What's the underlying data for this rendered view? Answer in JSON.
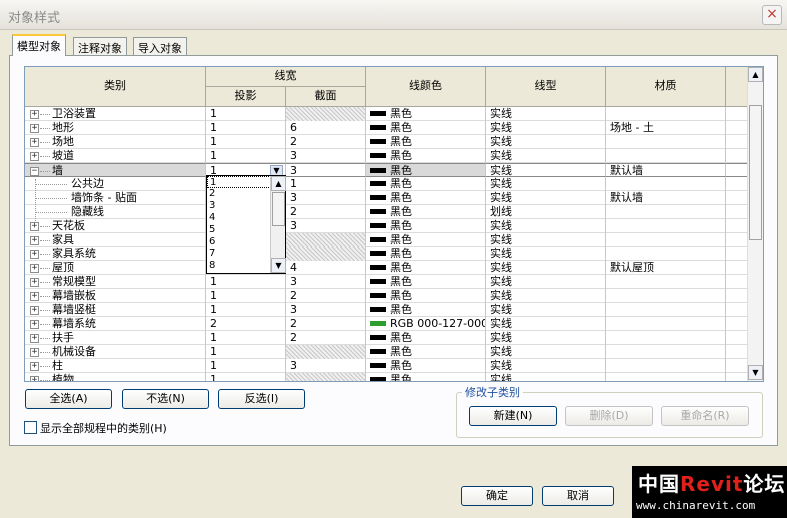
{
  "window": {
    "title": "对象样式",
    "close_symbol": "×"
  },
  "tabs": [
    {
      "label": "模型对象",
      "active": true
    },
    {
      "label": "注释对象",
      "active": false
    },
    {
      "label": "导入对象",
      "active": false
    }
  ],
  "grid": {
    "headers": {
      "category": "类别",
      "line_weight": "线宽",
      "projection": "投影",
      "cut": "截面",
      "line_color": "线颜色",
      "line_pattern": "线型",
      "material": "材质"
    },
    "rows": [
      {
        "name": "卫浴装置",
        "expander": "+",
        "proj": "1",
        "cut": "",
        "cut_hatched": true,
        "color": "黑色",
        "swatch": "#000000",
        "pattern": "实线",
        "material": ""
      },
      {
        "name": "地形",
        "expander": "+",
        "proj": "1",
        "cut": "6",
        "cut_hatched": false,
        "color": "黑色",
        "swatch": "#000000",
        "pattern": "实线",
        "material": "场地 - 土"
      },
      {
        "name": "场地",
        "expander": "+",
        "proj": "1",
        "cut": "2",
        "cut_hatched": false,
        "color": "黑色",
        "swatch": "#000000",
        "pattern": "实线",
        "material": ""
      },
      {
        "name": "坡道",
        "expander": "+",
        "proj": "1",
        "cut": "3",
        "cut_hatched": false,
        "color": "黑色",
        "swatch": "#000000",
        "pattern": "实线",
        "material": ""
      },
      {
        "name": "墙",
        "expander": "−",
        "proj": "1",
        "cut": "3",
        "cut_hatched": false,
        "color": "黑色",
        "swatch": "#000000",
        "pattern": "实线",
        "material": "默认墙",
        "selected": true
      },
      {
        "name": "公共边",
        "child": true,
        "proj": "",
        "cut": "1",
        "cut_hatched": false,
        "color": "黑色",
        "swatch": "#000000",
        "pattern": "实线",
        "material": ""
      },
      {
        "name": "墙饰条 - 贴面",
        "child": true,
        "proj": "",
        "cut": "3",
        "cut_hatched": false,
        "color": "黑色",
        "swatch": "#000000",
        "pattern": "实线",
        "material": "默认墙"
      },
      {
        "name": "隐藏线",
        "child": true,
        "proj": "",
        "cut": "2",
        "cut_hatched": false,
        "color": "黑色",
        "swatch": "#000000",
        "pattern": "划线",
        "material": ""
      },
      {
        "name": "天花板",
        "expander": "+",
        "proj": "",
        "cut": "3",
        "cut_hatched": false,
        "color": "黑色",
        "swatch": "#000000",
        "pattern": "实线",
        "material": ""
      },
      {
        "name": "家具",
        "expander": "+",
        "proj": "",
        "cut": "",
        "cut_hatched": true,
        "color": "黑色",
        "swatch": "#000000",
        "pattern": "实线",
        "material": ""
      },
      {
        "name": "家具系统",
        "expander": "+",
        "proj": "",
        "cut": "",
        "cut_hatched": true,
        "color": "黑色",
        "swatch": "#000000",
        "pattern": "实线",
        "material": ""
      },
      {
        "name": "屋顶",
        "expander": "+",
        "proj": "",
        "cut": "4",
        "cut_hatched": false,
        "color": "黑色",
        "swatch": "#000000",
        "pattern": "实线",
        "material": "默认屋顶"
      },
      {
        "name": "常规模型",
        "expander": "+",
        "proj": "1",
        "cut": "3",
        "cut_hatched": false,
        "color": "黑色",
        "swatch": "#000000",
        "pattern": "实线",
        "material": ""
      },
      {
        "name": "幕墙嵌板",
        "expander": "+",
        "proj": "1",
        "cut": "2",
        "cut_hatched": false,
        "color": "黑色",
        "swatch": "#000000",
        "pattern": "实线",
        "material": ""
      },
      {
        "name": "幕墙竖梃",
        "expander": "+",
        "proj": "1",
        "cut": "3",
        "cut_hatched": false,
        "color": "黑色",
        "swatch": "#000000",
        "pattern": "实线",
        "material": ""
      },
      {
        "name": "幕墙系统",
        "expander": "+",
        "proj": "2",
        "cut": "2",
        "cut_hatched": false,
        "color": "RGB 000-127-000",
        "swatch": "#2f9e2f",
        "pattern": "实线",
        "material": ""
      },
      {
        "name": "扶手",
        "expander": "+",
        "proj": "1",
        "cut": "2",
        "cut_hatched": false,
        "color": "黑色",
        "swatch": "#000000",
        "pattern": "实线",
        "material": ""
      },
      {
        "name": "机械设备",
        "expander": "+",
        "proj": "1",
        "cut": "",
        "cut_hatched": true,
        "color": "黑色",
        "swatch": "#000000",
        "pattern": "实线",
        "material": ""
      },
      {
        "name": "柱",
        "expander": "+",
        "proj": "1",
        "cut": "3",
        "cut_hatched": false,
        "color": "黑色",
        "swatch": "#000000",
        "pattern": "实线",
        "material": ""
      },
      {
        "name": "植物",
        "expander": "+",
        "proj": "1",
        "cut": "",
        "cut_hatched": true,
        "color": "黑色",
        "swatch": "#000000",
        "pattern": "实线",
        "material": ""
      }
    ]
  },
  "dropdown": {
    "selected": "1",
    "options": [
      "1",
      "2",
      "3",
      "4",
      "5",
      "6",
      "7",
      "8"
    ]
  },
  "buttons": {
    "select_all": "全选(A)",
    "select_none": "不选(N)",
    "invert": "反选(I)",
    "new": "新建(N)",
    "delete": "删除(D)",
    "rename": "重命名(R)",
    "ok": "确定",
    "cancel": "取消"
  },
  "subcategory_group": {
    "title": "修改子类别"
  },
  "checkbox": {
    "label": "显示全部规程中的类别(H)",
    "checked": false
  },
  "watermark": {
    "prefix": "中国",
    "brand": "Revit",
    "suffix": "论坛",
    "url": "www.chinarevit.com"
  },
  "colors": {
    "accent_tab": "#ffc83c",
    "group_title": "#1f4fa0",
    "watermark_red": "#e0201a"
  }
}
